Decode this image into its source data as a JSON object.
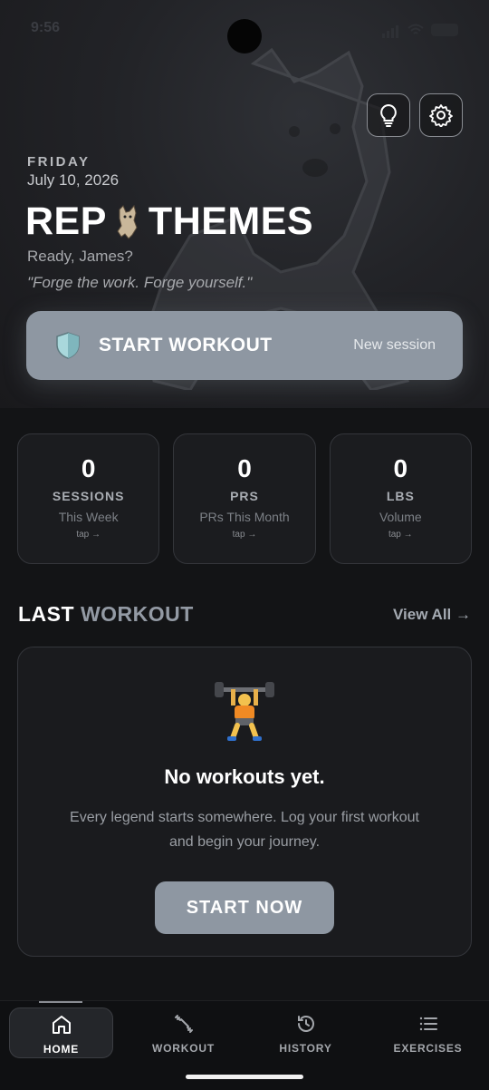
{
  "status": {
    "time": "9:56"
  },
  "hero": {
    "day": "FRIDAY",
    "date": "July 10, 2026",
    "brand_left": "REP",
    "brand_right": "THEMES",
    "greeting": "Ready, James?",
    "quote": "\"Forge the work. Forge yourself.\"",
    "tip_icon": "lightbulb-icon",
    "settings_icon": "gear-icon"
  },
  "start_workout": {
    "label": "START WORKOUT",
    "sub": "New session",
    "icon": "shield-icon"
  },
  "stats": [
    {
      "value": "0",
      "label": "SESSIONS",
      "sub": "This Week",
      "tap": "tap →"
    },
    {
      "value": "0",
      "label": "PRS",
      "sub": "PRs This Month",
      "tap": "tap →"
    },
    {
      "value": "0",
      "label": "LBS",
      "sub": "Volume",
      "tap": "tap →"
    }
  ],
  "last_workout": {
    "title_a": "LAST",
    "title_b": "WORKOUT",
    "view_all": "View All →",
    "empty_title": "No workouts yet.",
    "empty_text": "Every legend starts somewhere. Log your first workout and begin your journey.",
    "start_now": "START NOW"
  },
  "nav": [
    {
      "label": "HOME",
      "icon": "home-icon",
      "active": true
    },
    {
      "label": "WORKOUT",
      "icon": "dumbbell-icon",
      "active": false
    },
    {
      "label": "HISTORY",
      "icon": "history-icon",
      "active": false
    },
    {
      "label": "EXERCISES",
      "icon": "list-icon",
      "active": false
    }
  ],
  "colors": {
    "accent": "#8e97a2",
    "background": "#131416",
    "card": "#1b1c1f"
  }
}
